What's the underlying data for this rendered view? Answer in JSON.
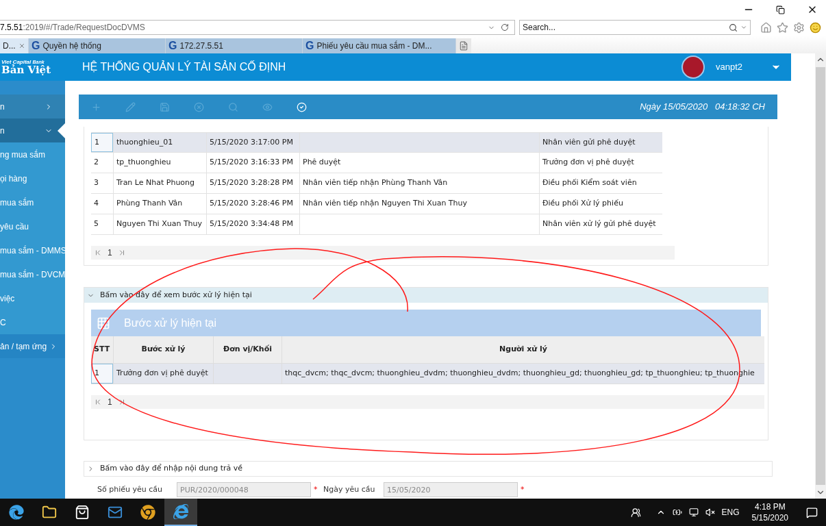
{
  "browser": {
    "address_host": "7.5.51",
    "address_path": ":2019/#/Trade/RequestDocDVMS",
    "search": {
      "placeholder": "Search..."
    },
    "tabs": [
      {
        "label": "D...",
        "selected": true,
        "closable": true
      },
      {
        "label": "Quyền hệ thống",
        "selected": false,
        "closable": false,
        "favicon": "G"
      },
      {
        "label": "172.27.5.51",
        "selected": false,
        "closable": false,
        "favicon": "G"
      },
      {
        "label": "Phiếu yêu cầu mua sắm - DM...",
        "selected": false,
        "closable": false,
        "favicon": "G"
      }
    ]
  },
  "header": {
    "logo_top": "Viet Capital",
    "logo_bank": "Bank",
    "logo_name": "Bản Việt",
    "title": "HỆ THỐNG QUẢN LÝ TÀI SẢN CỐ ĐỊNH",
    "user": "vanpt2"
  },
  "sidebar": {
    "items": [
      {
        "label": "n",
        "kind": "group",
        "expanded": false,
        "selected": false
      },
      {
        "label": "n",
        "kind": "group",
        "expanded": true,
        "selected": true
      },
      {
        "label": "ng mua sắm",
        "kind": "link",
        "selected": false
      },
      {
        "label": "ọi hàng",
        "kind": "link",
        "selected": false
      },
      {
        "label": "mua sắm",
        "kind": "link",
        "selected": false
      },
      {
        "label": "yêu cầu",
        "kind": "link",
        "selected": false
      },
      {
        "label": "mua sắm - DMMS",
        "kind": "link",
        "selected": false
      },
      {
        "label": "mua sắm - DVCM",
        "kind": "link",
        "selected": false
      },
      {
        "label": "việc",
        "kind": "link",
        "selected": false
      },
      {
        "label": "C",
        "kind": "link",
        "selected": false
      },
      {
        "label": "ản / tạm ứng",
        "kind": "group",
        "expanded": false,
        "selected": false
      }
    ]
  },
  "toolbar": {
    "buttons": [
      {
        "kind": "add",
        "disabled": true
      },
      {
        "kind": "edit",
        "disabled": true
      },
      {
        "kind": "save",
        "disabled": true
      },
      {
        "kind": "delete",
        "disabled": true
      },
      {
        "kind": "search",
        "disabled": true
      },
      {
        "kind": "view",
        "disabled": true
      },
      {
        "kind": "approve",
        "disabled": false
      }
    ],
    "datetime": "Ngày 15/05/2020   04:18:32 CH"
  },
  "history_table": {
    "rows": [
      {
        "selected": true,
        "cells": [
          "1",
          "thuonghieu_01",
          "5/15/2020 3:17:00 PM",
          "",
          "Nhân viên gửi phê duyệt"
        ]
      },
      {
        "selected": false,
        "cells": [
          "2",
          "tp_thuonghieu",
          "5/15/2020 3:16:33 PM",
          "Phê duyệt",
          "Trưởng đơn vị phê duyệt"
        ]
      },
      {
        "selected": false,
        "cells": [
          "3",
          "Tran Le Nhat Phuong",
          "5/15/2020 3:28:28 PM",
          "Nhân viên tiếp nhận Phùng Thanh Vân",
          "Điều phối Kiểm soát viên"
        ]
      },
      {
        "selected": false,
        "cells": [
          "4",
          "Phùng Thanh Vân",
          "5/15/2020 3:28:46 PM",
          "Nhân viên tiếp nhận Nguyen Thi Xuan Thuy",
          "Điều phối Xử lý phiếu"
        ]
      },
      {
        "selected": false,
        "cells": [
          "5",
          "Nguyen Thi Xuan Thuy",
          "5/15/2020 3:34:48 PM",
          "",
          "Nhân viên xử lý gửi phê duyệt"
        ]
      }
    ],
    "pager": {
      "page": "1"
    }
  },
  "current_step_section": {
    "toggle": "Bấm vào đây để xem bước xử lý hiện tại",
    "expanded": true,
    "panel_title": "Bước xử lý hiện tại",
    "columns": [
      "STT",
      "Bước xử lý",
      "Đơn vị/Khối",
      "Người xử lý"
    ],
    "rows": [
      {
        "selected": true,
        "cells": [
          "1",
          "Trưởng đơn vị phê duyệt",
          "",
          "thqc_dvcm; thqc_dvcm; thuonghieu_dvdm; thuonghieu_dvdm; thuonghieu_gd; thuonghieu_gd; tp_thuonghieu; tp_thuonghie"
        ]
      }
    ],
    "pager": {
      "page": "1"
    }
  },
  "return_section": {
    "toggle": "Bấm vào đây để nhập nội dung trả về",
    "expanded": false
  },
  "form": {
    "fields": [
      {
        "label": "Số phiếu yêu cầu",
        "value": "PUR/2020/000048",
        "required": true,
        "required_mark": "*"
      },
      {
        "label": "Ngày yêu cầu",
        "value": "15/05/2020",
        "required": true,
        "required_mark": "*"
      }
    ]
  },
  "taskbar": {
    "apps": [
      {
        "kind": "edge",
        "selected": false
      },
      {
        "kind": "folder",
        "selected": false
      },
      {
        "kind": "store",
        "selected": false
      },
      {
        "kind": "mail",
        "selected": false
      },
      {
        "kind": "chrome",
        "selected": false
      },
      {
        "kind": "ie",
        "selected": true
      }
    ],
    "language": "ENG",
    "time": "4:18 PM",
    "date": "5/15/2020"
  }
}
